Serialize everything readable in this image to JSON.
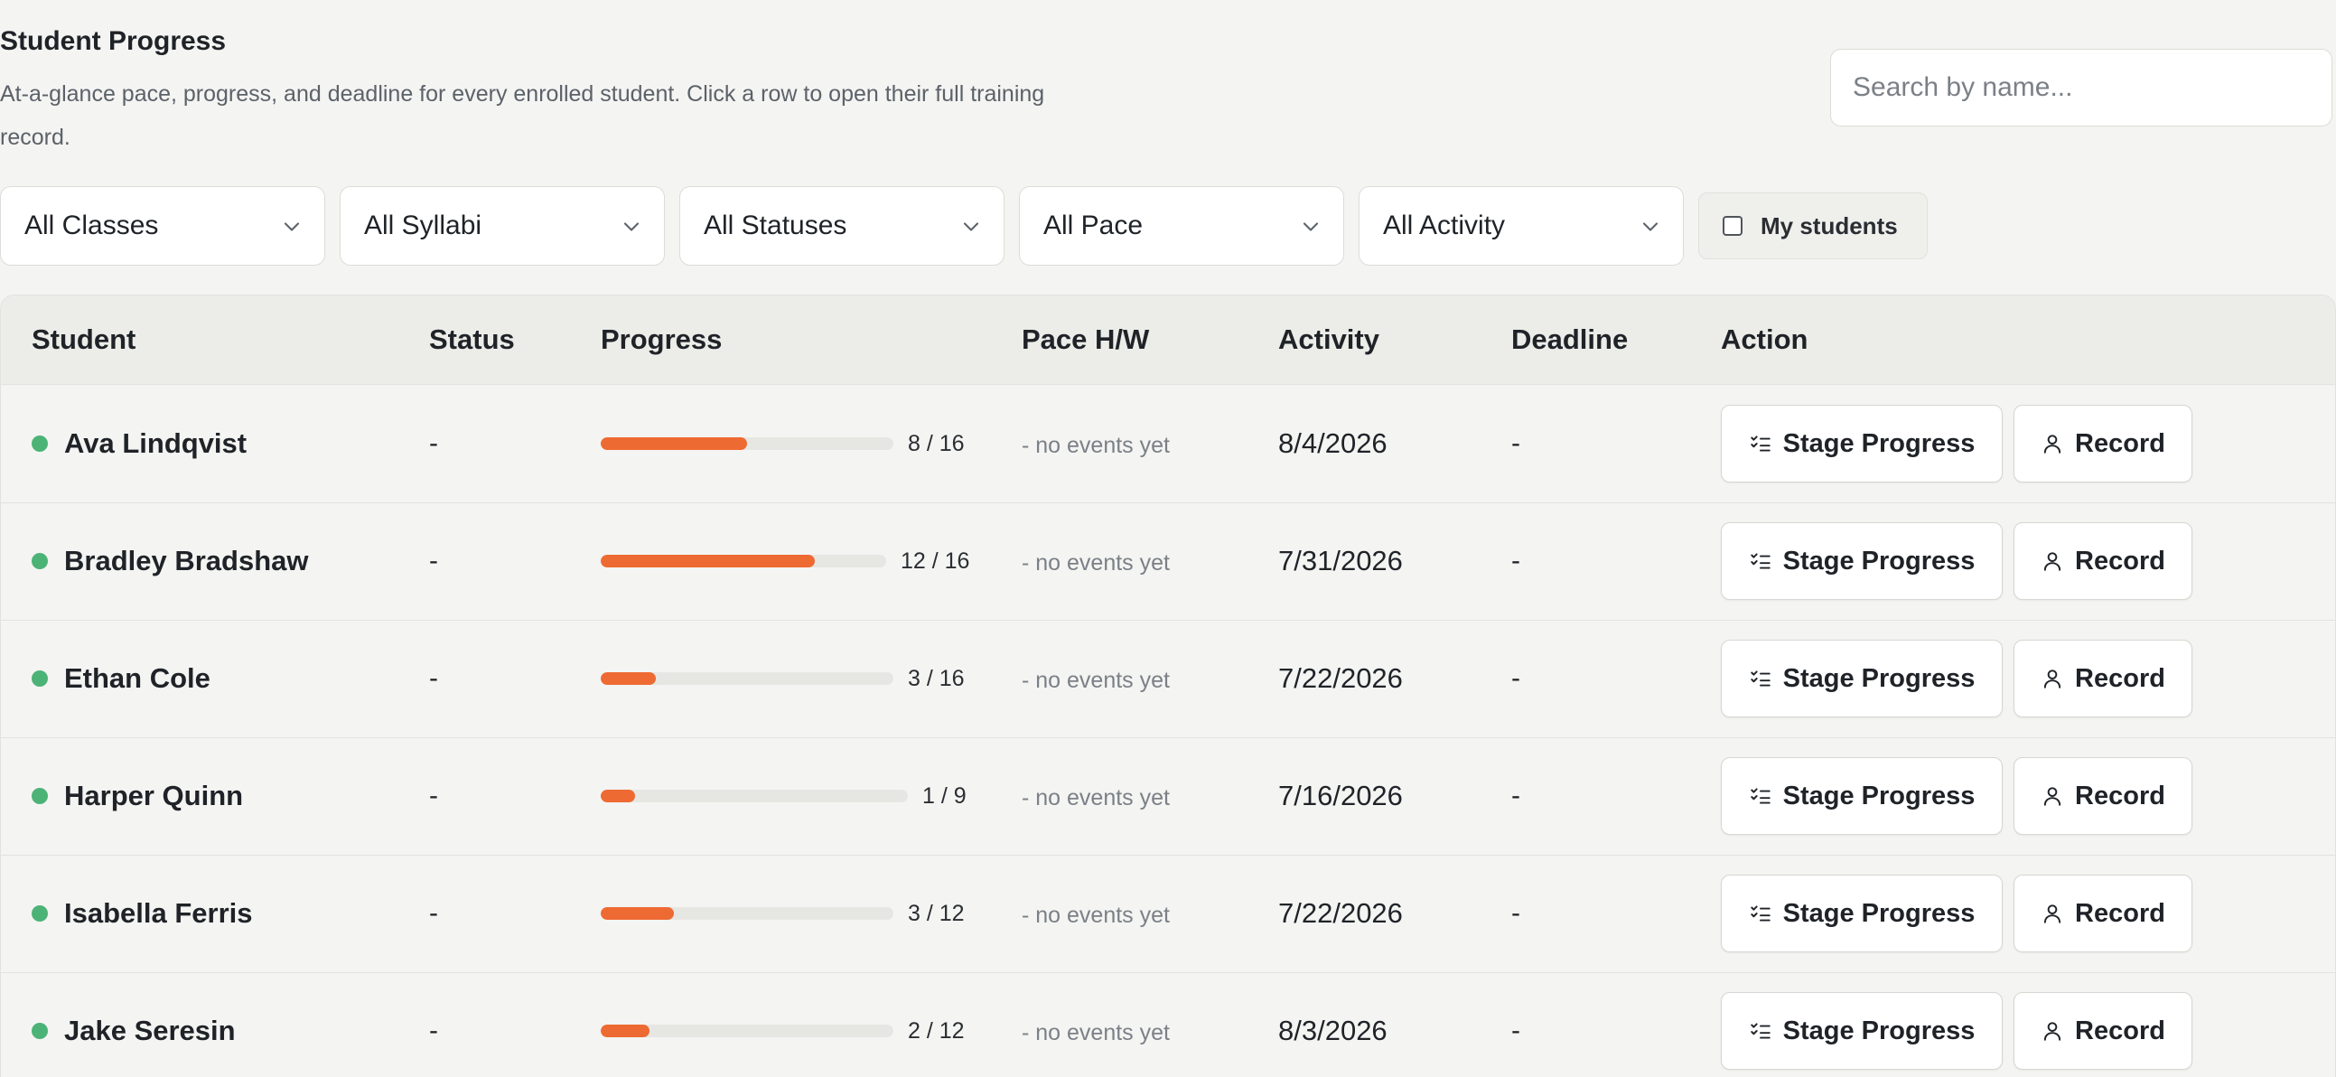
{
  "header": {
    "title": "Student Progress",
    "description": "At-a-glance pace, progress, and deadline for every enrolled student. Click a row to open their full training record."
  },
  "search": {
    "placeholder": "Search by name...",
    "value": ""
  },
  "filters": [
    {
      "label": "All Classes"
    },
    {
      "label": "All Syllabi"
    },
    {
      "label": "All Statuses"
    },
    {
      "label": "All Pace"
    },
    {
      "label": "All Activity"
    }
  ],
  "my_students": {
    "label": "My students",
    "checked": false
  },
  "table": {
    "columns": [
      "Student",
      "Status",
      "Progress",
      "Pace H/W",
      "Activity",
      "Deadline",
      "Action"
    ],
    "action_labels": {
      "stage": "Stage Progress",
      "record": "Record"
    },
    "rows": [
      {
        "name": "Ava Lindqvist",
        "status": "-",
        "completed": 8,
        "total": 16,
        "progress_label": "8 / 16",
        "pace": "- no events yet",
        "activity": "8/4/2026",
        "deadline": "-",
        "stage_label": "Stage Progress",
        "record_label": "Record"
      },
      {
        "name": "Bradley Bradshaw",
        "status": "-",
        "completed": 12,
        "total": 16,
        "progress_label": "12 / 16",
        "pace": "- no events yet",
        "activity": "7/31/2026",
        "deadline": "-",
        "stage_label": "Stage Progress",
        "record_label": "Record"
      },
      {
        "name": "Ethan Cole",
        "status": "-",
        "completed": 3,
        "total": 16,
        "progress_label": "3 / 16",
        "pace": "- no events yet",
        "activity": "7/22/2026",
        "deadline": "-",
        "stage_label": "Stage Progress",
        "record_label": "Record"
      },
      {
        "name": "Harper Quinn",
        "status": "-",
        "completed": 1,
        "total": 9,
        "progress_label": "1 / 9",
        "pace": "- no events yet",
        "activity": "7/16/2026",
        "deadline": "-",
        "stage_label": "Stage Progress",
        "record_label": "Record"
      },
      {
        "name": "Isabella Ferris",
        "status": "-",
        "completed": 3,
        "total": 12,
        "progress_label": "3 / 12",
        "pace": "- no events yet",
        "activity": "7/22/2026",
        "deadline": "-",
        "stage_label": "Stage Progress",
        "record_label": "Record"
      },
      {
        "name": "Jake Seresin",
        "status": "-",
        "completed": 2,
        "total": 12,
        "progress_label": "2 / 12",
        "pace": "- no events yet",
        "activity": "8/3/2026",
        "deadline": "-",
        "stage_label": "Stage Progress",
        "record_label": "Record"
      }
    ]
  },
  "colors": {
    "accent": "#ee6a33",
    "active_dot": "#4cb377",
    "track": "#e6e6e3"
  },
  "icons": {
    "filter_chevron": "chevron-down-icon",
    "stage_button": "checklist-icon",
    "record_button": "user-icon",
    "status_dot": "active-status-dot"
  }
}
